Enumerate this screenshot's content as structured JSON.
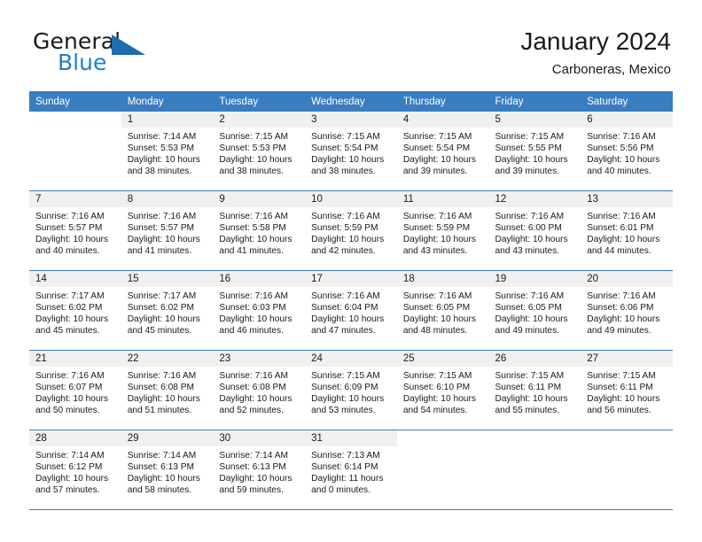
{
  "brand": {
    "line1": "General",
    "line2": "Blue",
    "accent_color": "#1f7fd0",
    "logo_icon": "triangle-flag-icon"
  },
  "header": {
    "title": "January 2024",
    "subtitle": "Carboneras, Mexico"
  },
  "calendar": {
    "header_bg": "#3a7dc0",
    "weekday_headers": [
      "Sunday",
      "Monday",
      "Tuesday",
      "Wednesday",
      "Thursday",
      "Friday",
      "Saturday"
    ],
    "weeks": [
      [
        {
          "day": "",
          "sunrise": "",
          "sunset": "",
          "daylight1": "",
          "daylight2": ""
        },
        {
          "day": "1",
          "sunrise": "Sunrise: 7:14 AM",
          "sunset": "Sunset: 5:53 PM",
          "daylight1": "Daylight: 10 hours",
          "daylight2": "and 38 minutes."
        },
        {
          "day": "2",
          "sunrise": "Sunrise: 7:15 AM",
          "sunset": "Sunset: 5:53 PM",
          "daylight1": "Daylight: 10 hours",
          "daylight2": "and 38 minutes."
        },
        {
          "day": "3",
          "sunrise": "Sunrise: 7:15 AM",
          "sunset": "Sunset: 5:54 PM",
          "daylight1": "Daylight: 10 hours",
          "daylight2": "and 38 minutes."
        },
        {
          "day": "4",
          "sunrise": "Sunrise: 7:15 AM",
          "sunset": "Sunset: 5:54 PM",
          "daylight1": "Daylight: 10 hours",
          "daylight2": "and 39 minutes."
        },
        {
          "day": "5",
          "sunrise": "Sunrise: 7:15 AM",
          "sunset": "Sunset: 5:55 PM",
          "daylight1": "Daylight: 10 hours",
          "daylight2": "and 39 minutes."
        },
        {
          "day": "6",
          "sunrise": "Sunrise: 7:16 AM",
          "sunset": "Sunset: 5:56 PM",
          "daylight1": "Daylight: 10 hours",
          "daylight2": "and 40 minutes."
        }
      ],
      [
        {
          "day": "7",
          "sunrise": "Sunrise: 7:16 AM",
          "sunset": "Sunset: 5:57 PM",
          "daylight1": "Daylight: 10 hours",
          "daylight2": "and 40 minutes."
        },
        {
          "day": "8",
          "sunrise": "Sunrise: 7:16 AM",
          "sunset": "Sunset: 5:57 PM",
          "daylight1": "Daylight: 10 hours",
          "daylight2": "and 41 minutes."
        },
        {
          "day": "9",
          "sunrise": "Sunrise: 7:16 AM",
          "sunset": "Sunset: 5:58 PM",
          "daylight1": "Daylight: 10 hours",
          "daylight2": "and 41 minutes."
        },
        {
          "day": "10",
          "sunrise": "Sunrise: 7:16 AM",
          "sunset": "Sunset: 5:59 PM",
          "daylight1": "Daylight: 10 hours",
          "daylight2": "and 42 minutes."
        },
        {
          "day": "11",
          "sunrise": "Sunrise: 7:16 AM",
          "sunset": "Sunset: 5:59 PM",
          "daylight1": "Daylight: 10 hours",
          "daylight2": "and 43 minutes."
        },
        {
          "day": "12",
          "sunrise": "Sunrise: 7:16 AM",
          "sunset": "Sunset: 6:00 PM",
          "daylight1": "Daylight: 10 hours",
          "daylight2": "and 43 minutes."
        },
        {
          "day": "13",
          "sunrise": "Sunrise: 7:16 AM",
          "sunset": "Sunset: 6:01 PM",
          "daylight1": "Daylight: 10 hours",
          "daylight2": "and 44 minutes."
        }
      ],
      [
        {
          "day": "14",
          "sunrise": "Sunrise: 7:17 AM",
          "sunset": "Sunset: 6:02 PM",
          "daylight1": "Daylight: 10 hours",
          "daylight2": "and 45 minutes."
        },
        {
          "day": "15",
          "sunrise": "Sunrise: 7:17 AM",
          "sunset": "Sunset: 6:02 PM",
          "daylight1": "Daylight: 10 hours",
          "daylight2": "and 45 minutes."
        },
        {
          "day": "16",
          "sunrise": "Sunrise: 7:16 AM",
          "sunset": "Sunset: 6:03 PM",
          "daylight1": "Daylight: 10 hours",
          "daylight2": "and 46 minutes."
        },
        {
          "day": "17",
          "sunrise": "Sunrise: 7:16 AM",
          "sunset": "Sunset: 6:04 PM",
          "daylight1": "Daylight: 10 hours",
          "daylight2": "and 47 minutes."
        },
        {
          "day": "18",
          "sunrise": "Sunrise: 7:16 AM",
          "sunset": "Sunset: 6:05 PM",
          "daylight1": "Daylight: 10 hours",
          "daylight2": "and 48 minutes."
        },
        {
          "day": "19",
          "sunrise": "Sunrise: 7:16 AM",
          "sunset": "Sunset: 6:05 PM",
          "daylight1": "Daylight: 10 hours",
          "daylight2": "and 49 minutes."
        },
        {
          "day": "20",
          "sunrise": "Sunrise: 7:16 AM",
          "sunset": "Sunset: 6:06 PM",
          "daylight1": "Daylight: 10 hours",
          "daylight2": "and 49 minutes."
        }
      ],
      [
        {
          "day": "21",
          "sunrise": "Sunrise: 7:16 AM",
          "sunset": "Sunset: 6:07 PM",
          "daylight1": "Daylight: 10 hours",
          "daylight2": "and 50 minutes."
        },
        {
          "day": "22",
          "sunrise": "Sunrise: 7:16 AM",
          "sunset": "Sunset: 6:08 PM",
          "daylight1": "Daylight: 10 hours",
          "daylight2": "and 51 minutes."
        },
        {
          "day": "23",
          "sunrise": "Sunrise: 7:16 AM",
          "sunset": "Sunset: 6:08 PM",
          "daylight1": "Daylight: 10 hours",
          "daylight2": "and 52 minutes."
        },
        {
          "day": "24",
          "sunrise": "Sunrise: 7:15 AM",
          "sunset": "Sunset: 6:09 PM",
          "daylight1": "Daylight: 10 hours",
          "daylight2": "and 53 minutes."
        },
        {
          "day": "25",
          "sunrise": "Sunrise: 7:15 AM",
          "sunset": "Sunset: 6:10 PM",
          "daylight1": "Daylight: 10 hours",
          "daylight2": "and 54 minutes."
        },
        {
          "day": "26",
          "sunrise": "Sunrise: 7:15 AM",
          "sunset": "Sunset: 6:11 PM",
          "daylight1": "Daylight: 10 hours",
          "daylight2": "and 55 minutes."
        },
        {
          "day": "27",
          "sunrise": "Sunrise: 7:15 AM",
          "sunset": "Sunset: 6:11 PM",
          "daylight1": "Daylight: 10 hours",
          "daylight2": "and 56 minutes."
        }
      ],
      [
        {
          "day": "28",
          "sunrise": "Sunrise: 7:14 AM",
          "sunset": "Sunset: 6:12 PM",
          "daylight1": "Daylight: 10 hours",
          "daylight2": "and 57 minutes."
        },
        {
          "day": "29",
          "sunrise": "Sunrise: 7:14 AM",
          "sunset": "Sunset: 6:13 PM",
          "daylight1": "Daylight: 10 hours",
          "daylight2": "and 58 minutes."
        },
        {
          "day": "30",
          "sunrise": "Sunrise: 7:14 AM",
          "sunset": "Sunset: 6:13 PM",
          "daylight1": "Daylight: 10 hours",
          "daylight2": "and 59 minutes."
        },
        {
          "day": "31",
          "sunrise": "Sunrise: 7:13 AM",
          "sunset": "Sunset: 6:14 PM",
          "daylight1": "Daylight: 11 hours",
          "daylight2": "and 0 minutes."
        },
        {
          "day": "",
          "sunrise": "",
          "sunset": "",
          "daylight1": "",
          "daylight2": ""
        },
        {
          "day": "",
          "sunrise": "",
          "sunset": "",
          "daylight1": "",
          "daylight2": ""
        },
        {
          "day": "",
          "sunrise": "",
          "sunset": "",
          "daylight1": "",
          "daylight2": ""
        }
      ]
    ]
  }
}
